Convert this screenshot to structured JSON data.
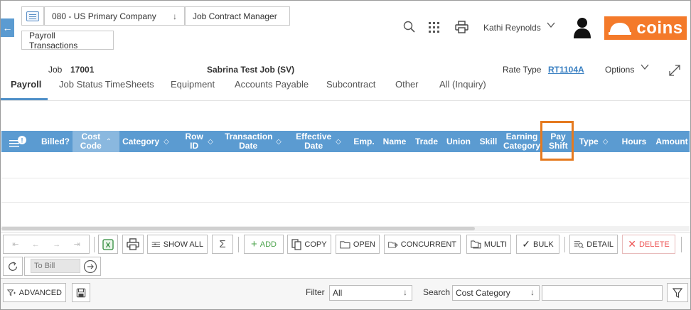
{
  "breadcrumb": {
    "company": "080 - US Primary Company",
    "module": "Job Contract Manager",
    "page": "Payroll Transactions"
  },
  "header": {
    "user_name": "Kathi Reynolds",
    "logo_text": "coins",
    "logo_color": "#f47a2a"
  },
  "job_info": {
    "job_label": "Job",
    "job_number": "17001",
    "job_name": "Sabrina Test Job (SV)",
    "rate_type_label": "Rate Type",
    "rate_type_value": "RT1104A",
    "options_label": "Options"
  },
  "tabs": [
    {
      "label": "Payroll",
      "active": true
    },
    {
      "label": "Job Status TimeSheets"
    },
    {
      "label": "Equipment"
    },
    {
      "label": "Accounts Payable"
    },
    {
      "label": "Subcontract"
    },
    {
      "label": "Other"
    },
    {
      "label": "All (Inquiry)"
    }
  ],
  "grid": {
    "header_color": "#5b9bd1",
    "columns": [
      {
        "label": "Billed?"
      },
      {
        "label": "Cost Code",
        "sorted": "asc"
      },
      {
        "label": "Category",
        "sortable": true
      },
      {
        "label": "Row ID",
        "sortable": true
      },
      {
        "label": "Transaction Date",
        "sortable": true
      },
      {
        "label": "Effective Date",
        "sortable": true
      },
      {
        "label": "Emp."
      },
      {
        "label": "Name"
      },
      {
        "label": "Trade"
      },
      {
        "label": "Union"
      },
      {
        "label": "Skill"
      },
      {
        "label": "Earning Category"
      },
      {
        "label": "Pay Shift",
        "highlighted": true
      },
      {
        "label": "Type",
        "sortable": true
      },
      {
        "label": "Hours"
      },
      {
        "label": "Amount"
      }
    ],
    "rows": []
  },
  "toolbar": {
    "show_all": "SHOW ALL",
    "add": "ADD",
    "copy": "COPY",
    "open": "OPEN",
    "concurrent": "CONCURRENT",
    "multi": "MULTI",
    "bulk": "BULK",
    "detail": "DETAIL",
    "delete": "DELETE",
    "to_bill_placeholder": "To Bill"
  },
  "bottom": {
    "advanced": "ADVANCED",
    "filter_label": "Filter",
    "filter_value": "All",
    "search_label": "Search",
    "search_field": "Cost Category",
    "search_value": ""
  },
  "highlight_color": "#e57a1f"
}
